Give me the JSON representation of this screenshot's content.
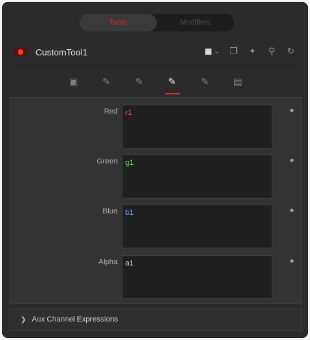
{
  "tabs": [
    {
      "label": "Tools"
    },
    {
      "label": "Modifiers"
    }
  ],
  "header": {
    "tool_name": "CustomTool1",
    "icons": [
      "color-swatch-icon",
      "chevron-down-icon",
      "copy-icon",
      "pin-icon",
      "lock-icon",
      "reset-icon"
    ]
  },
  "inner_tabs": [
    "controls-tab-icon",
    "edit-tab-icon",
    "edit-tab-icon",
    "channels-tab-icon",
    "edit-tab-icon",
    "settings-tab-icon"
  ],
  "channels": [
    {
      "label": "Red",
      "value": "r1",
      "color": "#ff4a4a"
    },
    {
      "label": "Green",
      "value": "g1",
      "color": "#6fd86f"
    },
    {
      "label": "Blue",
      "value": "b1",
      "color": "#6ea0ff"
    },
    {
      "label": "Alpha",
      "value": "a1",
      "color": "#d8d8d8"
    }
  ],
  "aux": {
    "label": "Aux Channel Expressions",
    "expanded": false
  },
  "colors": {
    "accent": "#e0272a",
    "panel": "#333333",
    "background": "#2b2b2b"
  }
}
